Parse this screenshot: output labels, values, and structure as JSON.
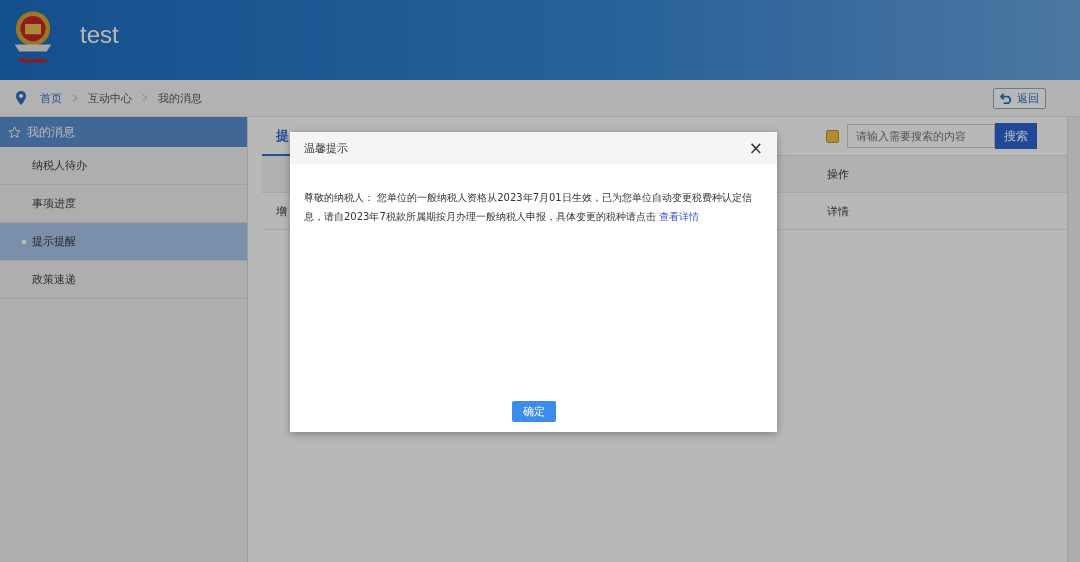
{
  "header": {
    "title": "test"
  },
  "breadcrumb": [
    "首页",
    "互动中心",
    "我的消息"
  ],
  "back_button": "返回",
  "sidebar": {
    "title": "我的消息",
    "items": [
      {
        "label": "纳税人待办",
        "selected": false
      },
      {
        "label": "事项进度",
        "selected": false
      },
      {
        "label": "提示提醒",
        "selected": true
      },
      {
        "label": "政策速递",
        "selected": false
      }
    ]
  },
  "tab": {
    "label": "提",
    "selected": true
  },
  "search": {
    "placeholder": "请输入需要搜索的内容",
    "button": "搜索"
  },
  "table": {
    "columns": [
      "操作"
    ],
    "rows": [
      {
        "column_1": "增",
        "action": "详情"
      }
    ]
  },
  "dialog": {
    "title": "温馨提示",
    "close": "×",
    "message": "尊敬的纳税人：  您单位的一般纳税人资格从2023年7月01日生效，已为您单位自动变更税费种认定信息，请自2023年7税款所属期按月办理一般纳税人申报，具体变更的税种请点击",
    "link": "查看详情",
    "ok": "确定"
  }
}
